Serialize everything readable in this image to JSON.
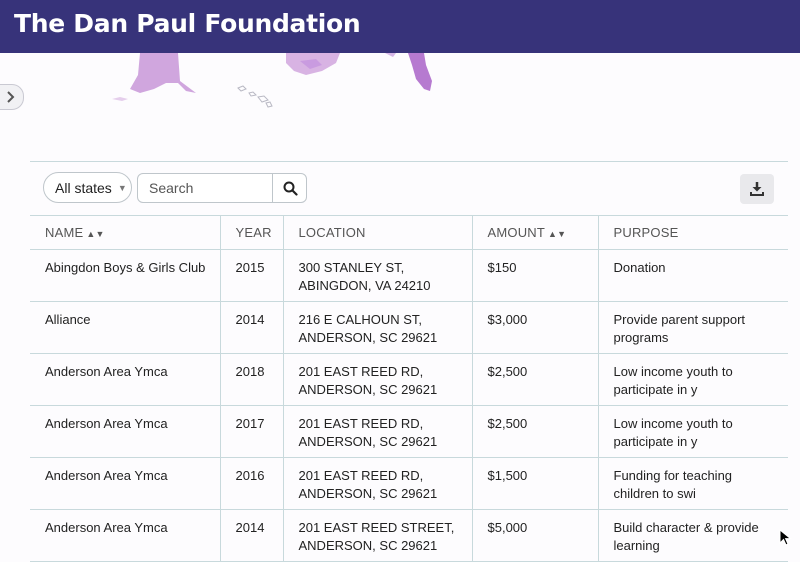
{
  "header": {
    "title": "The Dan Paul Foundation"
  },
  "colors": {
    "header_bg": "#37337a",
    "link": "#1d5f8a",
    "map_purple": "#b57ac9"
  },
  "toolbar": {
    "state_filter": "All states",
    "search_placeholder": "Search",
    "search_icon": "search-icon",
    "download_icon": "download-icon"
  },
  "table": {
    "columns": [
      "NAME",
      "YEAR",
      "LOCATION",
      "AMOUNT",
      "PURPOSE"
    ],
    "rows": [
      {
        "name": "Abingdon Boys & Girls Club",
        "linked": false,
        "year": "2015",
        "loc1": "300 STANLEY ST,",
        "loc2": "ABINGDON, VA 24210",
        "amount": "$150",
        "purpose": "Donation"
      },
      {
        "name": "Alliance",
        "linked": true,
        "year": "2014",
        "loc1": "216 E CALHOUN ST,",
        "loc2": "ANDERSON, SC 29621",
        "amount": "$3,000",
        "purpose": "Provide parent support programs"
      },
      {
        "name": "Anderson Area Ymca",
        "linked": false,
        "year": "2018",
        "loc1": "201 EAST REED RD,",
        "loc2": "ANDERSON, SC 29621",
        "amount": "$2,500",
        "purpose": "Low income youth to participate in y"
      },
      {
        "name": "Anderson Area Ymca",
        "linked": false,
        "year": "2017",
        "loc1": "201 EAST REED RD,",
        "loc2": "ANDERSON, SC 29621",
        "amount": "$2,500",
        "purpose": "Low income youth to participate in y"
      },
      {
        "name": "Anderson Area Ymca",
        "linked": false,
        "year": "2016",
        "loc1": "201 EAST REED RD,",
        "loc2": "ANDERSON, SC 29621",
        "amount": "$1,500",
        "purpose": "Funding for teaching children to swi"
      },
      {
        "name": "Anderson Area Ymca",
        "linked": true,
        "year": "2014",
        "loc1": "201 EAST REED STREET,",
        "loc2": "ANDERSON, SC 29621",
        "amount": "$5,000",
        "purpose": "Build character & provide learning"
      }
    ]
  }
}
